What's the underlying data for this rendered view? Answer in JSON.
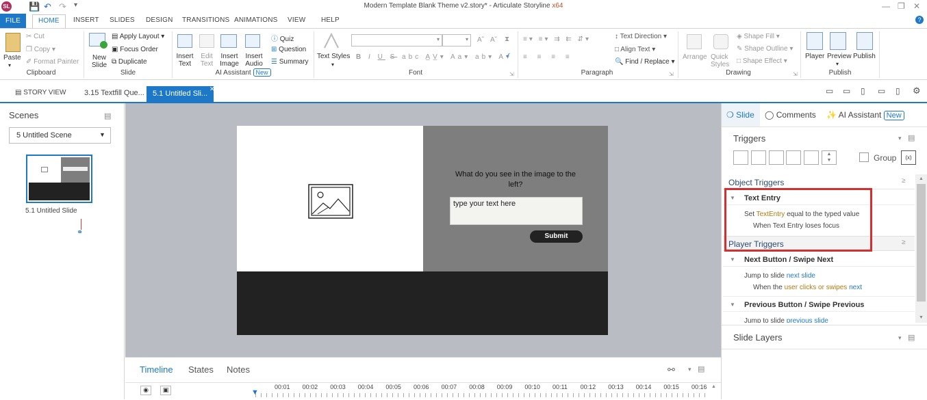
{
  "window": {
    "title": "Modern Template Blank Theme v2.story* - Articulate Storyline",
    "arch": "x64",
    "logo": "SL"
  },
  "ribbon_tabs": [
    "FILE",
    "HOME",
    "INSERT",
    "SLIDES",
    "DESIGN",
    "TRANSITIONS",
    "ANIMATIONS",
    "VIEW",
    "HELP"
  ],
  "clipboard": {
    "paste": "Paste",
    "cut": "Cut",
    "copy": "Copy",
    "format_painter": "Format Painter",
    "label": "Clipboard"
  },
  "slide_grp": {
    "new_slide": "New Slide",
    "apply_layout": "Apply Layout",
    "focus_order": "Focus Order",
    "duplicate": "Duplicate",
    "label": "Slide"
  },
  "ai_grp": {
    "insert_text": "Insert Text",
    "edit_text": "Edit Text",
    "insert_image": "Insert Image",
    "insert_audio": "Insert Audio",
    "quiz": "Quiz",
    "question": "Question",
    "summary": "Summary",
    "label": "AI Assistant",
    "new": "New"
  },
  "font_grp": {
    "text_styles": "Text Styles",
    "label": "Font"
  },
  "paragraph_grp": {
    "text_direction": "Text Direction",
    "align_text": "Align Text",
    "find_replace": "Find / Replace",
    "label": "Paragraph"
  },
  "drawing_grp": {
    "arrange": "Arrange",
    "quick_styles": "Quick Styles",
    "shape_fill": "Shape Fill",
    "shape_outline": "Shape Outline",
    "shape_effect": "Shape Effect",
    "label": "Drawing"
  },
  "publish_grp": {
    "player": "Player",
    "preview": "Preview",
    "publish": "Publish",
    "label": "Publish"
  },
  "doc_tabs": {
    "story_view": "STORY VIEW",
    "tab1": "3.15 Textfill Que...",
    "tab2": "5.1 Untitled Sli..."
  },
  "scenes": {
    "title": "Scenes",
    "selected": "5 Untitled Scene",
    "slide_label": "5.1 Untitled Slide"
  },
  "slide": {
    "question": "What do you see in the image to the left?",
    "placeholder": "type your text here",
    "submit": "Submit"
  },
  "timeline": {
    "tabs": [
      "Timeline",
      "States",
      "Notes"
    ],
    "ticks": [
      "00:01",
      "00:02",
      "00:03",
      "00:04",
      "00:05",
      "00:06",
      "00:07",
      "00:08",
      "00:09",
      "00:10",
      "00:11",
      "00:12",
      "00:13",
      "00:14",
      "00:15",
      "00:16"
    ]
  },
  "right_panel": {
    "tab_slide": "Slide",
    "tab_comments": "Comments",
    "tab_ai": "AI Assistant",
    "tab_ai_new": "New",
    "triggers_title": "Triggers",
    "group_label": "Group",
    "object_triggers": "Object Triggers",
    "text_entry": "Text Entry",
    "te_set": "Set",
    "te_var": "TextEntry",
    "te_rest": "equal to the typed value",
    "te_when": "When Text Entry loses focus",
    "player_triggers": "Player Triggers",
    "next_title": "Next Button / Swipe Next",
    "next_action": "Jump to slide",
    "next_target": "next slide",
    "next_when_a": "When the",
    "next_when_b": "user clicks or swipes",
    "next_when_c": "next",
    "prev_title": "Previous Button / Swipe Previous",
    "prev_action": "Jump to slide",
    "prev_target": "previous slide",
    "slide_layers": "Slide Layers"
  },
  "colors": {
    "accent": "#1e78c8",
    "highlight_box": "#d32f2f",
    "slide_dark": "#222222",
    "slide_gray": "#7e7e7e"
  }
}
